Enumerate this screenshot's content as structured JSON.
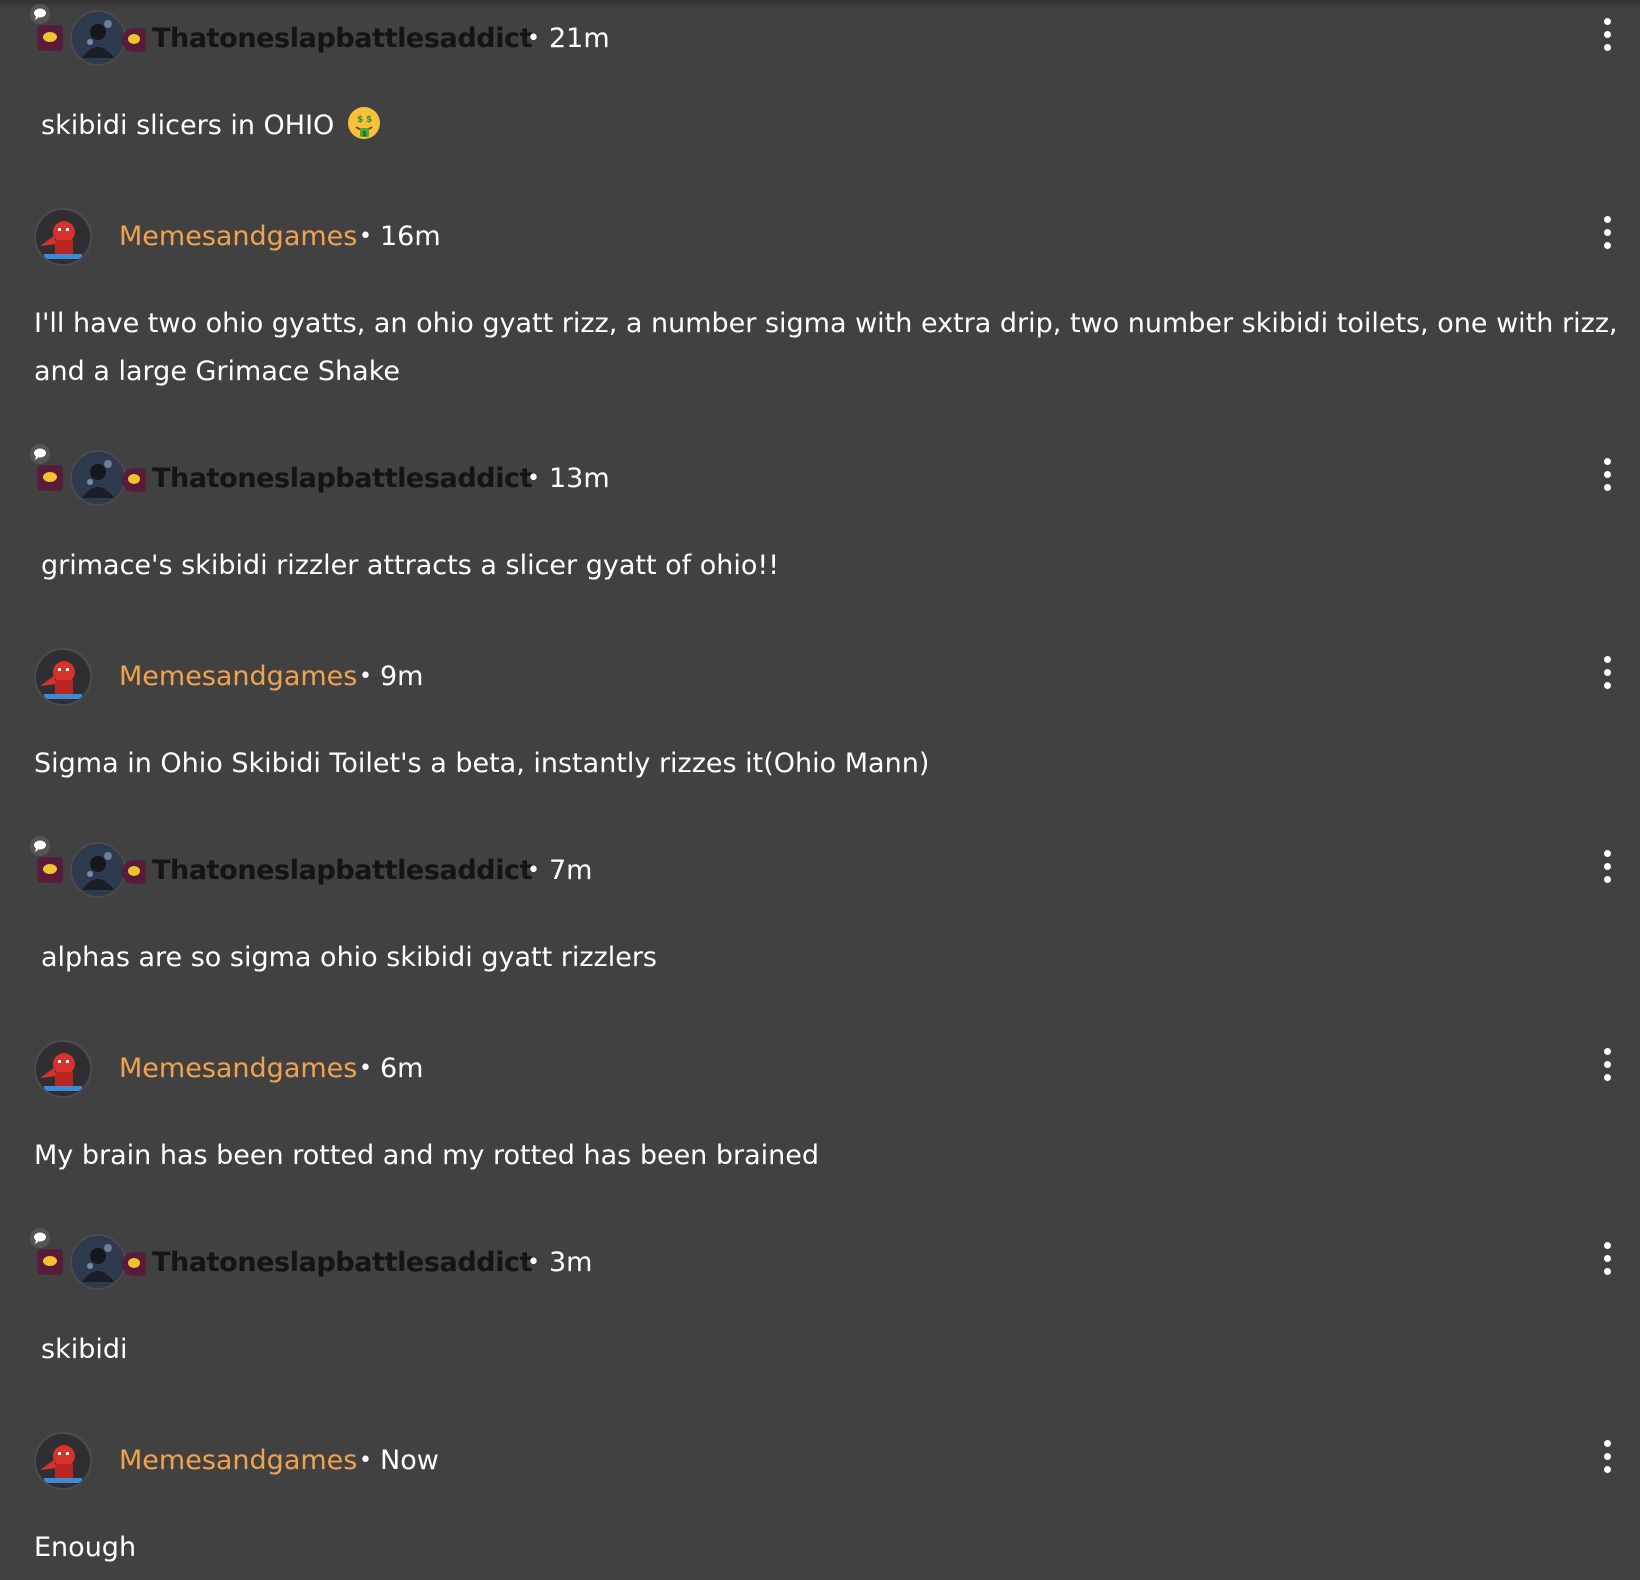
{
  "comments": [
    {
      "author": "Thatoneslapbattlesaddict",
      "author_style": "dark",
      "time": "21m",
      "text": "skibidi slicers in OHIO",
      "emoji": "money-mouth-face-emoji"
    },
    {
      "author": "Memesandgames",
      "author_style": "orange",
      "time": "16m",
      "text": "I'll have two ohio gyatts, an ohio gyatt rizz, a number sigma with extra drip, two number skibidi toilets, one with rizz, and a large Grimace Shake"
    },
    {
      "author": "Thatoneslapbattlesaddict",
      "author_style": "dark",
      "time": "13m",
      "text": "grimace's skibidi rizzler attracts a slicer gyatt of ohio!!"
    },
    {
      "author": "Memesandgames",
      "author_style": "orange",
      "time": "9m",
      "text": "Sigma in Ohio Skibidi Toilet's a beta, instantly rizzes it(Ohio Mann)"
    },
    {
      "author": "Thatoneslapbattlesaddict",
      "author_style": "dark",
      "time": "7m",
      "text": "alphas are so sigma ohio skibidi gyatt rizzlers"
    },
    {
      "author": "Memesandgames",
      "author_style": "orange",
      "time": "6m",
      "text": "My brain has been rotted and my rotted has been brained"
    },
    {
      "author": "Thatoneslapbattlesaddict",
      "author_style": "dark",
      "time": "3m",
      "text": "skibidi"
    },
    {
      "author": "Memesandgames",
      "author_style": "orange",
      "time": "Now",
      "text": "Enough"
    }
  ],
  "separator": "•",
  "icons": {
    "menu": "more-vertical-icon",
    "avatar_frame": "chat-bubble-flower-frame"
  },
  "colors": {
    "background": "#414141",
    "username_orange": "#f0a34e",
    "username_dark": "#141414",
    "text": "#ffffff",
    "frame_purple": "#5a1a3c",
    "frame_gold": "#f2c230"
  }
}
